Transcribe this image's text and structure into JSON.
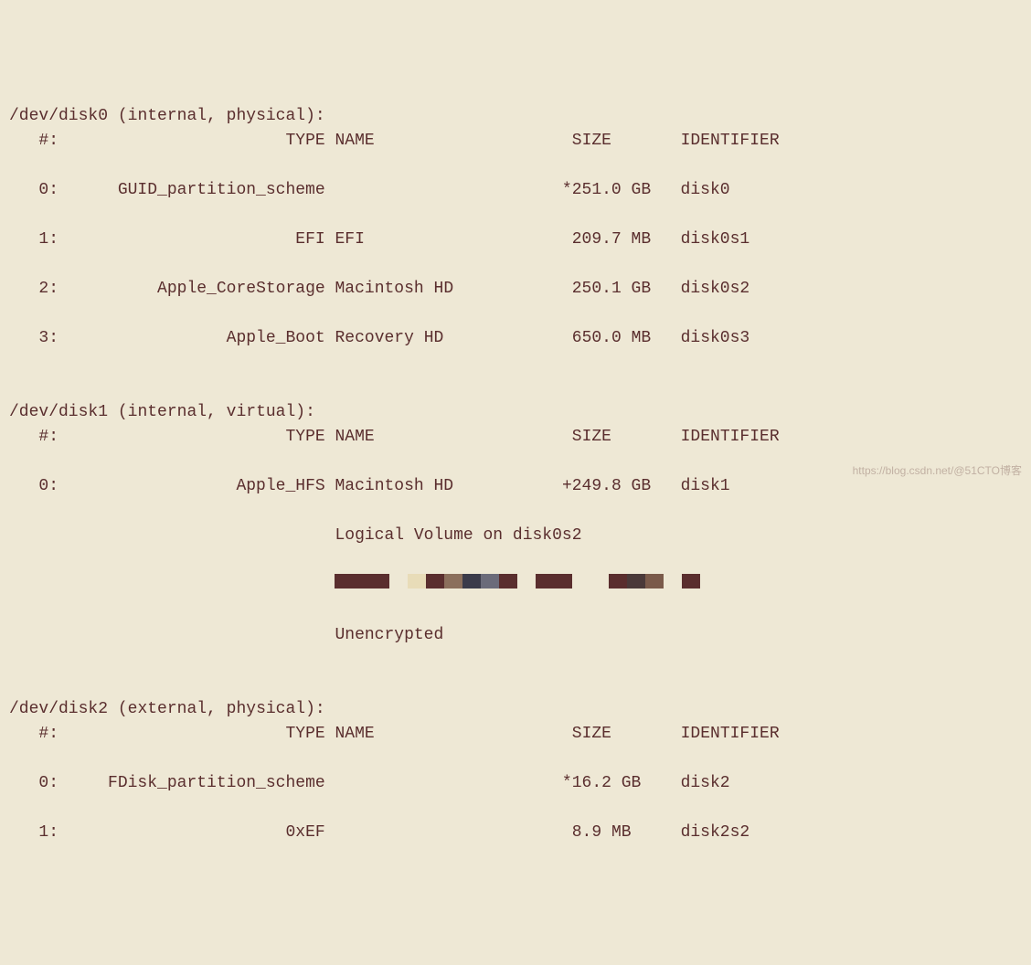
{
  "disks": [
    {
      "device": "/dev/disk0",
      "attributes": "(internal, physical)",
      "header": {
        "col_num": "#:",
        "col_type": "TYPE",
        "col_name": "NAME",
        "col_size": "SIZE",
        "col_identifier": "IDENTIFIER"
      },
      "partitions": [
        {
          "num": "0:",
          "type": "GUID_partition_scheme",
          "name": "",
          "size": "*251.0 GB",
          "identifier": "disk0"
        },
        {
          "num": "1:",
          "type": "EFI",
          "name": "EFI",
          "size": "209.7 MB",
          "identifier": "disk0s1"
        },
        {
          "num": "2:",
          "type": "Apple_CoreStorage",
          "name": "Macintosh HD",
          "size": "250.1 GB",
          "identifier": "disk0s2"
        },
        {
          "num": "3:",
          "type": "Apple_Boot",
          "name": "Recovery HD",
          "size": "650.0 MB",
          "identifier": "disk0s3"
        }
      ]
    },
    {
      "device": "/dev/disk1",
      "attributes": "(internal, virtual)",
      "header": {
        "col_num": "#:",
        "col_type": "TYPE",
        "col_name": "NAME",
        "col_size": "SIZE",
        "col_identifier": "IDENTIFIER"
      },
      "partitions": [
        {
          "num": "0:",
          "type": "Apple_HFS",
          "name": "Macintosh HD",
          "size": "+249.8 GB",
          "identifier": "disk1"
        }
      ],
      "extra_lines": [
        "Logical Volume on disk0s2",
        "[REDACTED]",
        "Unencrypted"
      ]
    },
    {
      "device": "/dev/disk2",
      "attributes": "(external, physical)",
      "header": {
        "col_num": "#:",
        "col_type": "TYPE",
        "col_name": "NAME",
        "col_size": "SIZE",
        "col_identifier": "IDENTIFIER"
      },
      "partitions": [
        {
          "num": "0:",
          "type": "FDisk_partition_scheme",
          "name": "",
          "size": "*16.2 GB",
          "identifier": "disk2"
        },
        {
          "num": "1:",
          "type": "0xEF",
          "name": "",
          "size": "8.9 MB",
          "identifier": "disk2s2"
        }
      ]
    }
  ],
  "mosaic_colors": [
    "#5a2e2e",
    "#5a2e2e",
    "#5a2e2e",
    "#eee8d5",
    "#e8dcb8",
    "#5a2e2e",
    "#8b6f5c",
    "#3b3b4a",
    "#6b6b7a",
    "#5a2e2e",
    "#eee8d5",
    "#5a2e2e",
    "#5a2e2e",
    "#eee8d5",
    "#eee8d5",
    "#5a2e2e",
    "#4a3939",
    "#7a5a4a",
    "#eee8d5",
    "#5a2e2e"
  ],
  "watermark": "https://blog.csdn.net/@51CTO博客"
}
